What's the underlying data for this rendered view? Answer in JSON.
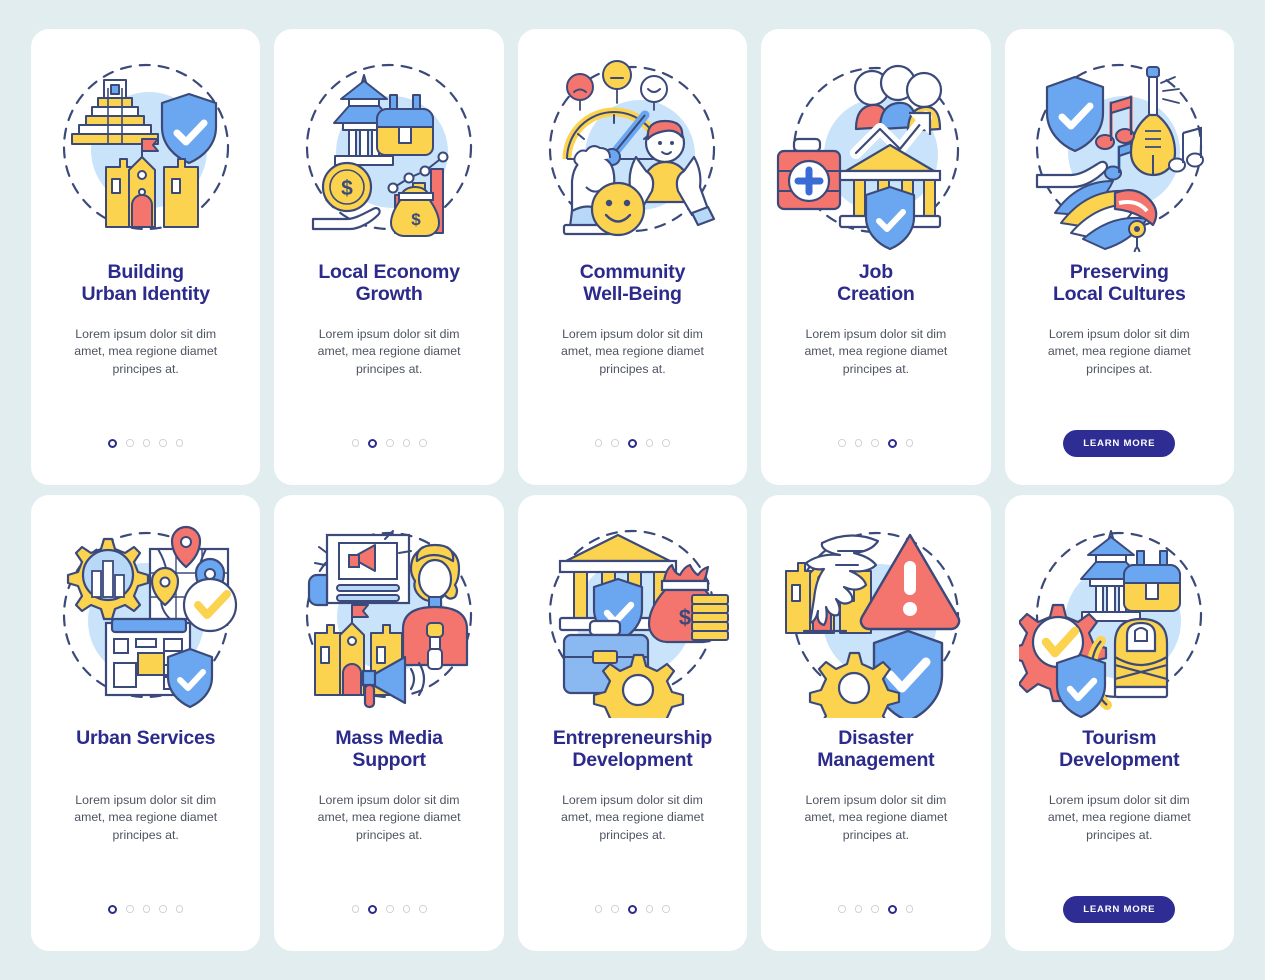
{
  "page": {
    "background_color": "#e2edf0",
    "card_background": "#ffffff",
    "title_color": "#2c2b8c",
    "body_color": "#4d5360",
    "accent_yellow": "#fcd34e",
    "accent_blue": "#6ba7f0",
    "accent_light_blue": "#bfdcf7",
    "accent_red": "#f4756e",
    "outline_navy": "#3b4a7a",
    "button_color": "#2e2d94",
    "dot_active_color": "#2c2b8c",
    "dot_inactive_color": "#cfd3da"
  },
  "common": {
    "body_text": "Lorem ipsum dolor sit dim amet, mea regione diamet principes at.",
    "learn_more_label": "LEARN MORE",
    "dot_count": 5
  },
  "cards": [
    {
      "id": "building-urban-identity",
      "title": "Building\nUrban Identity",
      "title_line1": "Building",
      "title_line2": "Urban Identity",
      "body": "Lorem ipsum dolor sit dim amet, mea regione diamet principes at.",
      "active_dot": 1,
      "has_button": false,
      "icon_name": "pyramid-castle-shield-illustration"
    },
    {
      "id": "local-economy-growth",
      "title": "Local Economy\nGrowth",
      "title_line1": "Local Economy",
      "title_line2": "Growth",
      "body": "Lorem ipsum dolor sit dim amet, mea regione diamet principes at.",
      "active_dot": 2,
      "has_button": false,
      "icon_name": "pagoda-coin-moneybag-chart-illustration"
    },
    {
      "id": "community-well-being",
      "title": "Community\nWell-Being",
      "title_line1": "Community",
      "title_line2": "Well-Being",
      "body": "Lorem ipsum dolor sit dim amet, mea regione diamet principes at.",
      "active_dot": 3,
      "has_button": false,
      "icon_name": "mood-gauge-people-smiley-illustration"
    },
    {
      "id": "job-creation",
      "title": "Job\nCreation",
      "title_line1": "Job",
      "title_line2": "Creation",
      "body": "Lorem ipsum dolor sit dim amet, mea regione diamet principes at.",
      "active_dot": 4,
      "has_button": false,
      "icon_name": "firstaid-people-growtharrow-bank-illustration"
    },
    {
      "id": "preserving-local-cultures",
      "title": "Preserving\nLocal Cultures",
      "title_line1": "Preserving",
      "title_line2": "Local Cultures",
      "body": "Lorem ipsum dolor sit dim amet, mea regione diamet principes at.",
      "active_dot": 0,
      "has_button": true,
      "icon_name": "shield-hand-headdress-lute-music-illustration"
    },
    {
      "id": "urban-services",
      "title": "Urban Services",
      "title_line1": "Urban Services",
      "title_line2": "",
      "body": "Lorem ipsum dolor sit dim amet, mea regione diamet principes at.",
      "active_dot": 1,
      "has_button": false,
      "icon_name": "gear-city-map-blueprint-shield-illustration"
    },
    {
      "id": "mass-media-support",
      "title": "Mass Media\nSupport",
      "title_line1": "Mass Media",
      "title_line2": "Support",
      "body": "Lorem ipsum dolor sit dim amet, mea regione diamet principes at.",
      "active_dot": 2,
      "has_button": false,
      "icon_name": "newspaper-megaphone-reporter-castle-illustration"
    },
    {
      "id": "entrepreneurship-development",
      "title": "Entrepreneurship\nDevelopment",
      "title_line1": "Entrepreneurship",
      "title_line2": "Development",
      "body": "Lorem ipsum dolor sit dim amet, mea regione diamet principes at.",
      "active_dot": 3,
      "has_button": false,
      "icon_name": "bank-shield-moneybag-briefcase-gear-illustration"
    },
    {
      "id": "disaster-management",
      "title": "Disaster\nManagement",
      "title_line1": "Disaster",
      "title_line2": "Management",
      "body": "Lorem ipsum dolor sit dim amet, mea regione diamet principes at.",
      "active_dot": 4,
      "has_button": false,
      "icon_name": "castle-tornado-warning-shield-gear-illustration"
    },
    {
      "id": "tourism-development",
      "title": "Tourism\nDevelopment",
      "title_line1": "Tourism",
      "title_line2": "Development",
      "body": "Lorem ipsum dolor sit dim amet, mea regione diamet principes at.",
      "active_dot": 0,
      "has_button": true,
      "icon_name": "gear-check-pagoda-backpack-statue-shield-illustration"
    }
  ]
}
